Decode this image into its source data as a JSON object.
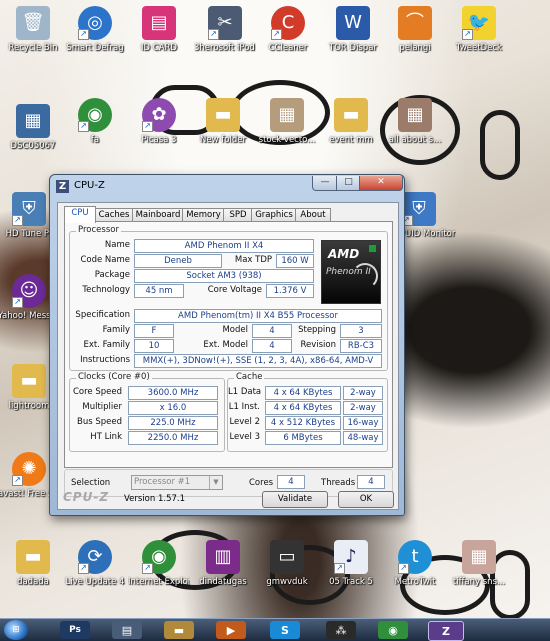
{
  "desktop": {
    "icons": [
      {
        "label": "Recycle Bin",
        "icon": "recycle-bin-icon",
        "color": "#9fb5c9",
        "glyph": "🗑"
      },
      {
        "label": "Smart Defrag",
        "icon": "smart-defrag-icon",
        "color": "#2c74c9",
        "glyph": "◎"
      },
      {
        "label": "ID CARD",
        "icon": "document-icon",
        "color": "#d8347a",
        "glyph": "▤"
      },
      {
        "label": "3herosoft iPod to ...",
        "icon": "tools-icon",
        "color": "#4c5b73",
        "glyph": "✂"
      },
      {
        "label": "CCleaner",
        "icon": "ccleaner-icon",
        "color": "#d23b2a",
        "glyph": "C"
      },
      {
        "label": "TOR Dispar",
        "icon": "word-document-icon",
        "color": "#2a5aa8",
        "glyph": "W"
      },
      {
        "label": "pelangi",
        "icon": "rainbow-icon",
        "color": "#e47c24",
        "glyph": "⌒"
      },
      {
        "label": "TweetDeck",
        "icon": "tweetdeck-icon",
        "color": "#f2d22e",
        "glyph": "🐦"
      },
      {
        "label": "DSC05067",
        "icon": "photo-icon",
        "color": "#3a6aa0",
        "glyph": "▦"
      },
      {
        "label": "fa",
        "icon": "chrome-icon",
        "color": "#2f8f3a",
        "glyph": "◉"
      },
      {
        "label": "Picasa 3",
        "icon": "picasa-icon",
        "color": "#8d4bb0",
        "glyph": "✿"
      },
      {
        "label": "New folder",
        "icon": "folder-icon",
        "color": "#e2b94d",
        "glyph": "▬"
      },
      {
        "label": "stock vecto...",
        "icon": "photo-icon",
        "color": "#b59c7d",
        "glyph": "▦"
      },
      {
        "label": "event mm",
        "icon": "folder-icon",
        "color": "#e2b94d",
        "glyph": "▬"
      },
      {
        "label": "all about s...",
        "icon": "photo-icon",
        "color": "#9b7b6a",
        "glyph": "▦"
      },
      {
        "label": "HD Tune Pr",
        "icon": "hd-tune-icon",
        "color": "#4a7fb5",
        "glyph": "⛨"
      },
      {
        "label": "CPUID Monitor",
        "icon": "shield-icon",
        "color": "#3d79c4",
        "glyph": "⛨"
      },
      {
        "label": "Yahoo! Messenger",
        "icon": "yahoo-messenger-icon",
        "color": "#6b2a95",
        "glyph": "☺"
      },
      {
        "label": "lightroom",
        "icon": "folder-icon",
        "color": "#e2b94d",
        "glyph": "▬"
      },
      {
        "label": "avast! Free Antivirus",
        "icon": "avast-icon",
        "color": "#f07a18",
        "glyph": "✺"
      },
      {
        "label": "dadada",
        "icon": "folder-icon",
        "color": "#e2b94d",
        "glyph": "▬"
      },
      {
        "label": "Live Update 4",
        "icon": "live-update-icon",
        "color": "#2d6fb8",
        "glyph": "⟳"
      },
      {
        "label": "Internet Explorer Tr...",
        "icon": "chrome-icon",
        "color": "#2f8f3a",
        "glyph": "◉"
      },
      {
        "label": "dindatugas",
        "icon": "winrar-icon",
        "color": "#7b2c8a",
        "glyph": "▥"
      },
      {
        "label": "gmwvduk",
        "icon": "device-icon",
        "color": "#333333",
        "glyph": "▭"
      },
      {
        "label": "05 Track 5",
        "icon": "mp3-icon",
        "color": "#e9eef6",
        "glyph": "♪"
      },
      {
        "label": "MetroTwit",
        "icon": "metrotwit-icon",
        "color": "#1f8fd6",
        "glyph": "t"
      },
      {
        "label": "tiffany sns...",
        "icon": "photo-icon",
        "color": "#c7a59a",
        "glyph": "▦"
      }
    ]
  },
  "taskbar": {
    "items": [
      {
        "name": "start-button",
        "glyph": ""
      },
      {
        "name": "photoshop-task",
        "glyph": "Ps",
        "color": "#1e3a63"
      },
      {
        "name": "document-task",
        "glyph": "▤",
        "color": "#4a5d78"
      },
      {
        "name": "explorer-task",
        "glyph": "▬",
        "color": "#b08a3a"
      },
      {
        "name": "media-player-task",
        "glyph": "▶",
        "color": "#c25a1b"
      },
      {
        "name": "skype-task",
        "glyph": "S",
        "color": "#1a8ad6"
      },
      {
        "name": "blackberry-task",
        "glyph": "⁂",
        "color": "#2a2a2a"
      },
      {
        "name": "chrome-task",
        "glyph": "◉",
        "color": "#2f8f3a"
      },
      {
        "name": "cpuz-task",
        "glyph": "Z",
        "color": "#5a3c8a"
      }
    ]
  },
  "window": {
    "title": "CPU-Z",
    "app_icon": "Z",
    "minimize": "—",
    "maximize": "□",
    "close": "✕",
    "tabs": [
      "CPU",
      "Caches",
      "Mainboard",
      "Memory",
      "SPD",
      "Graphics",
      "About"
    ],
    "active_tab": "CPU",
    "processor": {
      "group": "Processor",
      "name_label": "Name",
      "name": "AMD Phenom II X4",
      "codename_label": "Code Name",
      "codename": "Deneb",
      "maxtdp_label": "Max TDP",
      "maxtdp": "160 W",
      "package_label": "Package",
      "package": "Socket AM3 (938)",
      "technology_label": "Technology",
      "technology": "45 nm",
      "corevoltage_label": "Core Voltage",
      "corevoltage": "1.376 V",
      "specification_label": "Specification",
      "specification": "AMD Phenom(tm) II X4 B55 Processor",
      "family_label": "Family",
      "family": "F",
      "model_label": "Model",
      "model": "4",
      "stepping_label": "Stepping",
      "stepping": "3",
      "extfamily_label": "Ext. Family",
      "extfamily": "10",
      "extmodel_label": "Ext. Model",
      "extmodel": "4",
      "revision_label": "Revision",
      "revision": "RB-C3",
      "instructions_label": "Instructions",
      "instructions": "MMX(+), 3DNow!(+), SSE (1, 2, 3, 4A), x86-64, AMD-V",
      "logo_brand": "AMD",
      "logo_product": "Phenom II"
    },
    "clocks": {
      "group": "Clocks (Core #0)",
      "corespeed_label": "Core Speed",
      "corespeed": "3600.0 MHz",
      "multiplier_label": "Multiplier",
      "multiplier": "x 16.0",
      "busspeed_label": "Bus Speed",
      "busspeed": "225.0 MHz",
      "htlink_label": "HT Link",
      "htlink": "2250.0 MHz"
    },
    "cache": {
      "group": "Cache",
      "l1data_label": "L1 Data",
      "l1data": "4 x 64 KBytes",
      "l1data_way": "2-way",
      "l1inst_label": "L1 Inst.",
      "l1inst": "4 x 64 KBytes",
      "l1inst_way": "2-way",
      "level2_label": "Level 2",
      "level2": "4 x 512 KBytes",
      "level2_way": "16-way",
      "level3_label": "Level 3",
      "level3": "6 MBytes",
      "level3_way": "48-way"
    },
    "selection": {
      "label": "Selection",
      "value": "Processor #1",
      "cores_label": "Cores",
      "cores": "4",
      "threads_label": "Threads",
      "threads": "4"
    },
    "footer": {
      "brand": "CPU-Z",
      "version": "Version 1.57.1",
      "validate": "Validate",
      "ok": "OK"
    }
  }
}
